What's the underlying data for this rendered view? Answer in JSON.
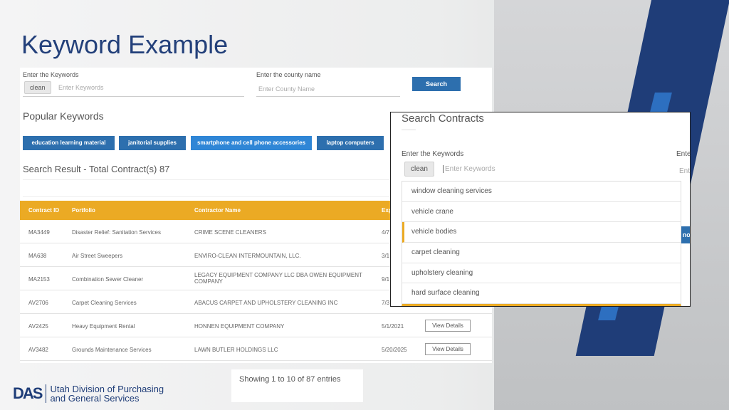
{
  "slide_title": "Keyword Example",
  "search": {
    "keywords_label": "Enter the Keywords",
    "keyword_chip": "clean",
    "keywords_placeholder": "Enter Keywords",
    "county_label": "Enter the county name",
    "county_placeholder": "Enter County Name",
    "search_button": "Search"
  },
  "popular": {
    "heading": "Popular Keywords",
    "items": [
      "education learning material",
      "janitorial supplies",
      "smartphone and cell phone accessories",
      "laptop computers"
    ]
  },
  "results": {
    "heading": "Search Result - Total Contract(s) 87",
    "columns": [
      "Contract ID",
      "Portfolio",
      "Contractor Name",
      "Exp"
    ],
    "rows": [
      {
        "id": "MA3449",
        "portfolio": "Disaster Relief: Sanitation Services",
        "contractor": "CRIME SCENE CLEANERS",
        "exp": "4/7"
      },
      {
        "id": "MA638",
        "portfolio": "Air Street Sweepers",
        "contractor": "ENVIRO-CLEAN INTERMOUNTAIN, LLC.",
        "exp": "3/1"
      },
      {
        "id": "MA2153",
        "portfolio": "Combination Sewer Cleaner",
        "contractor": "LEGACY EQUIPMENT COMPANY LLC DBA OWEN EQUIPMENT COMPANY",
        "exp": "9/1"
      },
      {
        "id": "AV2706",
        "portfolio": "Carpet Cleaning Services",
        "contractor": "ABACUS CARPET AND UPHOLSTERY CLEANING INC",
        "exp": "7/3"
      },
      {
        "id": "AV2425",
        "portfolio": "Heavy Equipment Rental",
        "contractor": "HONNEN EQUIPMENT COMPANY",
        "exp": "5/1/2021",
        "action": "View Details"
      },
      {
        "id": "AV3482",
        "portfolio": "Grounds Maintenance Services",
        "contractor": "LAWN BUTLER HOLDINGS LLC",
        "exp": "5/20/2025",
        "action": "View Details"
      }
    ],
    "showing": "Showing 1 to 10 of 87 entries"
  },
  "popup": {
    "title": "Search Contracts",
    "keywords_label": "Enter the Keywords",
    "keyword_chip": "clean",
    "keywords_placeholder": "Enter Keywords",
    "county_label_partial": "Ente",
    "county_placeholder_partial": "Ent",
    "button_partial": "nor",
    "suggestions": [
      "window cleaning services",
      "vehicle crane",
      "vehicle bodies",
      "carpet cleaning",
      "upholstery cleaning",
      "hard surface cleaning"
    ],
    "highlighted": "vehicle bodies"
  },
  "logo": {
    "mark": "DAS",
    "line1": "Utah Division of Purchasing",
    "line2": "and General Services"
  },
  "colors": {
    "accent": "#ebaa24",
    "primary": "#2d6fae",
    "brand": "#1f3d78"
  }
}
